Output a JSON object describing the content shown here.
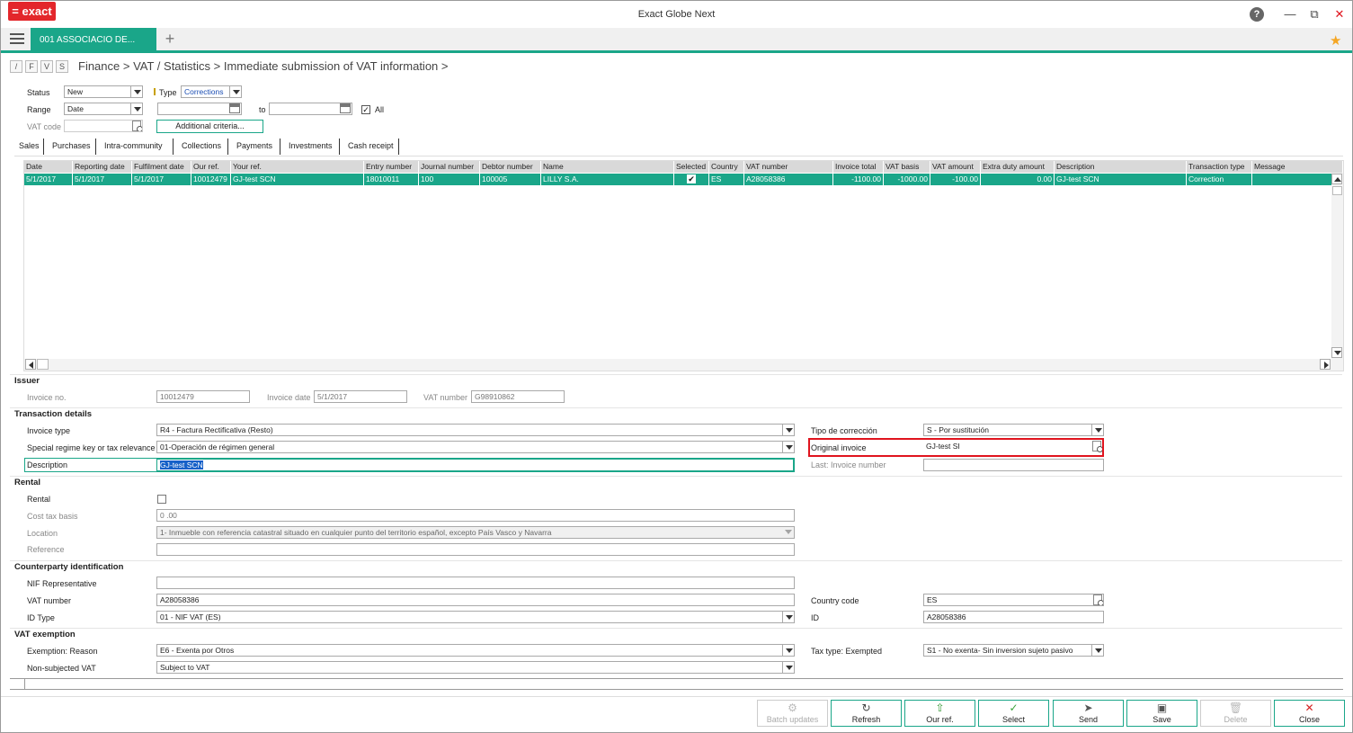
{
  "app": {
    "title": "Exact Globe Next",
    "logo": "= exact",
    "help": "?"
  },
  "window_controls": {
    "minimize": "—",
    "restore": "⧉",
    "close": "✕"
  },
  "tabs": {
    "active": "001  ASSOCIACIO DE...",
    "add": "+"
  },
  "breadcrumb": {
    "fvs": [
      "/",
      "F",
      "V",
      "S"
    ],
    "path": "Finance > VAT / Statistics > Immediate submission of VAT information >"
  },
  "filters": {
    "status_label": "Status",
    "status_value": "New",
    "type_label": "Type",
    "type_value": "Corrections",
    "range_label": "Range",
    "range_value": "Date",
    "to_label": "to",
    "all_label": "All",
    "all_checked": true,
    "vatcode_label": "VAT code",
    "additional_criteria": "Additional criteria..."
  },
  "subtabs": [
    "Sales",
    "Purchases",
    "Intra-community",
    "Collections",
    "Payments",
    "Investments",
    "Cash receipt"
  ],
  "grid": {
    "columns": [
      "Date",
      "Reporting date",
      "Fulfilment date",
      "Our ref.",
      "Your ref.",
      "Entry number",
      "Journal number",
      "Debtor number",
      "Name",
      "Selected",
      "Country",
      "VAT number",
      "Invoice total",
      "VAT basis",
      "VAT amount",
      "Extra duty amount",
      "Description",
      "Transaction type",
      "Message"
    ],
    "rows": [
      [
        "5/1/2017",
        "5/1/2017",
        "5/1/2017",
        "10012479",
        "GJ-test SCN",
        "18010011",
        "100",
        "100005",
        "LILLY S.A.",
        "✔",
        "ES",
        "A28058386",
        "-1100.00",
        "-1000.00",
        "-100.00",
        "0.00",
        "GJ-test SCN",
        "Correction",
        ""
      ]
    ]
  },
  "issuer": {
    "title": "Issuer",
    "invoice_no_label": "Invoice no.",
    "invoice_no": "10012479",
    "invoice_date_label": "Invoice date",
    "invoice_date": "5/1/2017",
    "vat_number_label": "VAT number",
    "vat_number": "G98910862"
  },
  "transaction": {
    "title": "Transaction details",
    "invoice_type_label": "Invoice type",
    "invoice_type": "R4 - Factura Rectificativa (Resto)",
    "regime_label": "Special regime key or tax relevance",
    "regime": "01-Operación de régimen general",
    "description_label": "Description",
    "description": "GJ-test SCN",
    "tipo_label": "Tipo de corrección",
    "tipo": "S - Por sustitución",
    "original_label": "Original invoice",
    "original": "GJ-test SI",
    "last_label": "Last: Invoice number",
    "last": ""
  },
  "rental": {
    "title": "Rental",
    "rental_label": "Rental",
    "cost_label": "Cost tax basis",
    "cost": "0 .00",
    "location_label": "Location",
    "location": "1- Inmueble con referencia catastral situado en cualquier punto del territorio español, excepto País Vasco y Navarra",
    "reference_label": "Reference",
    "reference": ""
  },
  "counterparty": {
    "title": "Counterparty identification",
    "nif_label": "NIF Representative",
    "nif": "",
    "vat_label": "VAT number",
    "vat": "A28058386",
    "idtype_label": "ID Type",
    "idtype": "01 - NIF VAT (ES)",
    "country_label": "Country code",
    "country": "ES",
    "id_label": "ID",
    "id": "A28058386"
  },
  "exemption": {
    "title": "VAT exemption",
    "reason_label": "Exemption: Reason",
    "reason": "E6 - Exenta por Otros",
    "nonsub_label": "Non-subjected VAT",
    "nonsub": "Subject to VAT",
    "taxtype_label": "Tax type: Exempted",
    "taxtype": "S1 - No exenta- Sin inversion sujeto pasivo"
  },
  "actions": [
    "Batch updates",
    "Refresh",
    "Our ref.",
    "Select",
    "Send",
    "Save",
    "Delete",
    "Close"
  ],
  "colors": {
    "accent": "#1aa689",
    "brand": "#e3262b",
    "highlight": "#e0141e"
  }
}
